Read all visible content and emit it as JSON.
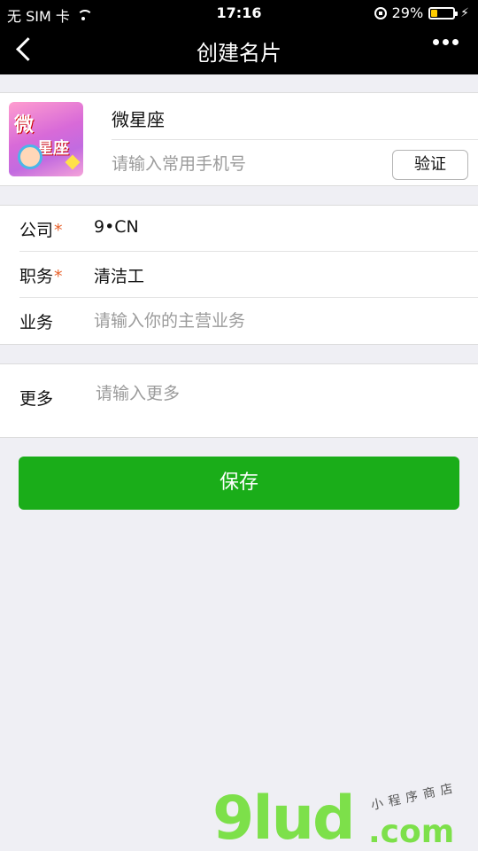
{
  "status_bar": {
    "carrier": "无 SIM 卡",
    "time": "17:16",
    "battery_percent": "29%",
    "battery_level": 0.29
  },
  "nav": {
    "title": "创建名片",
    "back_icon": "chevron-left-icon",
    "more_icon": "more-dots-icon"
  },
  "profile": {
    "name": "微星座",
    "avatar_text_1": "微",
    "avatar_text_2": "星座",
    "phone_placeholder": "请输入常用手机号",
    "verify_label": "验证"
  },
  "form": {
    "company": {
      "label": "公司",
      "required_mark": "*",
      "value": "9•CN"
    },
    "position": {
      "label": "职务",
      "required_mark": "*",
      "value": "清洁工"
    },
    "business": {
      "label": "业务",
      "placeholder": "请输入你的主营业务"
    }
  },
  "more": {
    "label": "更多",
    "placeholder": "请输入更多"
  },
  "save_label": "保存",
  "watermark": {
    "main": "9lud",
    "sub": "小程序商店",
    "com": ".com"
  },
  "colors": {
    "primary_green": "#1aad19",
    "required_orange": "#e8622c",
    "watermark_green": "#7de04a"
  }
}
